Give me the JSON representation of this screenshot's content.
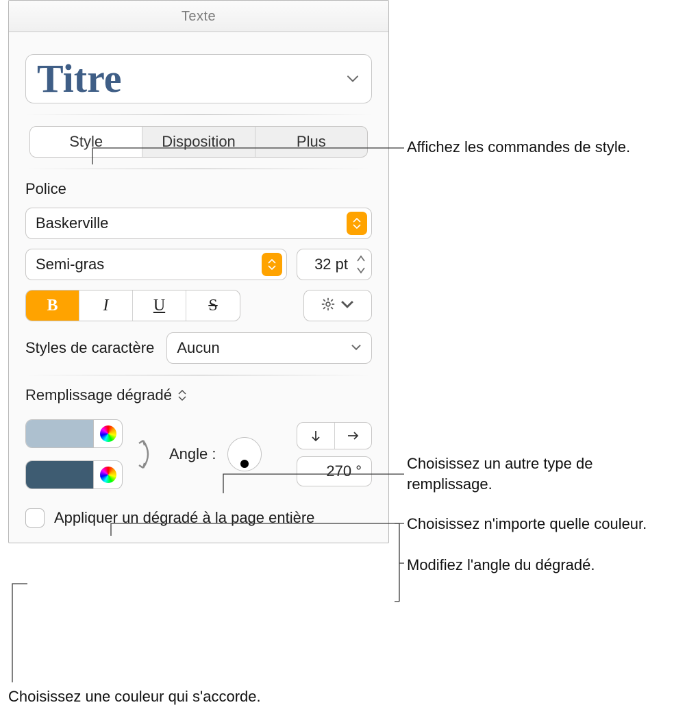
{
  "panel": {
    "tab": "Texte",
    "title_style": "Titre",
    "segments": {
      "style": "Style",
      "layout": "Disposition",
      "more": "Plus",
      "active": "style"
    }
  },
  "font": {
    "heading": "Police",
    "family": "Baskerville",
    "weight": "Semi-gras",
    "size": "32 pt",
    "buttons": {
      "bold": "B",
      "italic": "I",
      "underline": "U",
      "strike": "S"
    },
    "char_styles_label": "Styles de caractère",
    "char_styles_value": "Aucun"
  },
  "fill": {
    "heading": "Remplissage dégradé",
    "angle_label": "Angle :",
    "angle_value": "270 °",
    "colors": {
      "top": "#adc0cf",
      "bottom": "#3e5c72"
    },
    "apply_whole_page": "Appliquer un dégradé à la page entière"
  },
  "callouts": {
    "style": "Affichez les commandes de style.",
    "fill_type": "Choisissez un autre type de remplissage.",
    "any_color": "Choisissez n'importe quelle couleur.",
    "angle": "Modifiez l'angle du dégradé.",
    "theme_color": "Choisissez une couleur qui s'accorde."
  }
}
